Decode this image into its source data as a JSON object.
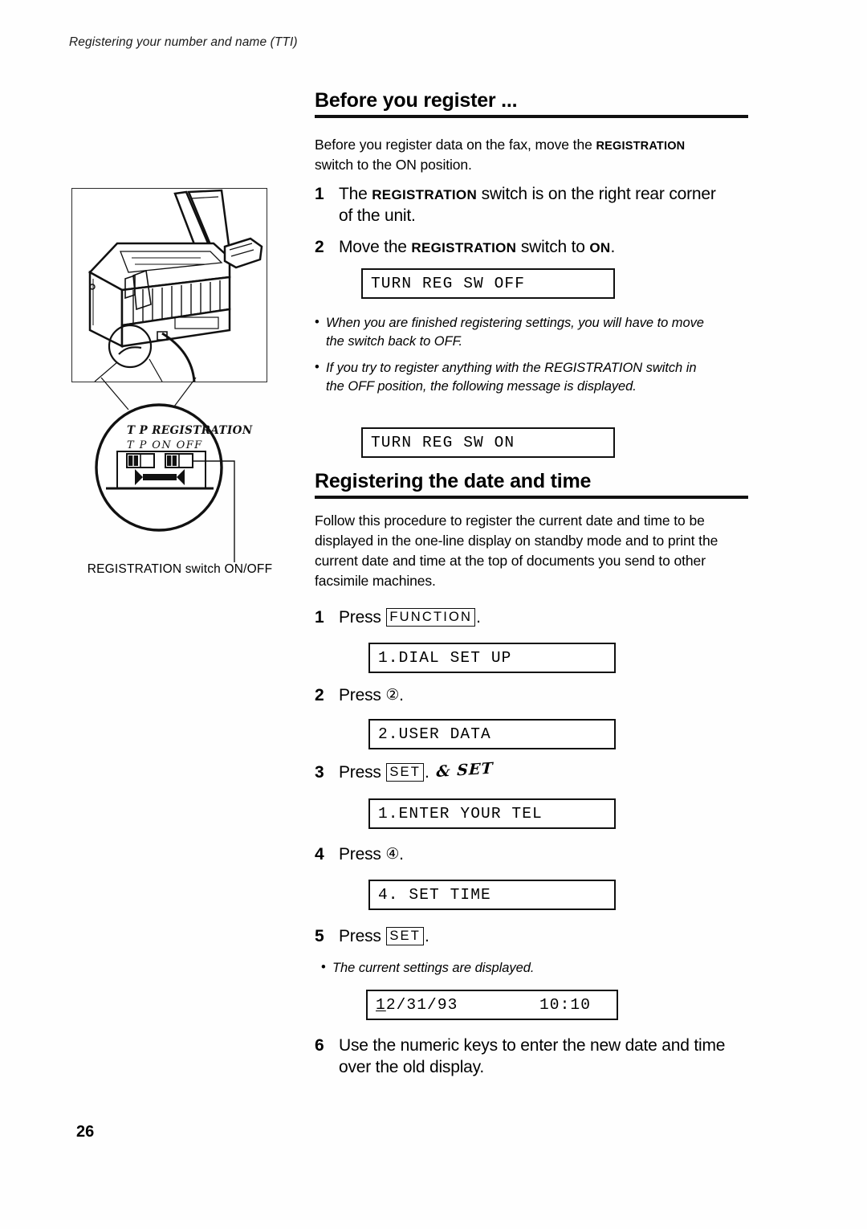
{
  "page": {
    "running_head": "Registering your number and name (TTI)",
    "number": "26"
  },
  "illustration": {
    "caption": "REGISTRATION switch ON/OFF",
    "callout_labels": {
      "line1": "T  P  REGISTRATION",
      "line2": "T   P   ON   OFF"
    }
  },
  "section1": {
    "heading": "Before you register ...",
    "intro_before": "Before you register data on the fax, move the ",
    "intro_sc": "REGISTRATION",
    "intro_after": " switch to the ON position.",
    "steps": [
      {
        "num": "1",
        "text_before": "The ",
        "sc": "REGISTRATION",
        "text_after": " switch is on the right rear corner of the unit."
      },
      {
        "num": "2",
        "text_before": "Move the ",
        "sc": "REGISTRATION",
        "text_mid": " switch to ",
        "sc2": "ON",
        "text_after": "."
      }
    ],
    "lcd1": "TURN REG SW OFF",
    "note1": "When you are finished registering settings, you will have to move the switch back to OFF.",
    "note2": "If you try to register anything with the REGISTRATION switch in the OFF position, the following message is displayed.",
    "lcd2": "TURN REG SW ON"
  },
  "section2": {
    "heading": "Registering the date and time",
    "intro": "Follow this procedure to register the current date and time to be displayed in the one-line display on standby mode and to print the current date and time at the top of documents you send to other facsimile machines.",
    "step1": {
      "num": "1",
      "press_label": "Press",
      "key": "FUNCTION",
      "period": ".",
      "lcd": "1.DIAL SET UP"
    },
    "step2": {
      "num": "2",
      "press_label": "Press",
      "key": "②",
      "period": ".",
      "lcd": "2.USER DATA"
    },
    "step3": {
      "num": "3",
      "press_label": "Press",
      "key": "SET",
      "period": ".",
      "handwritten_note": "& SET",
      "lcd": "1.ENTER YOUR TEL"
    },
    "step4": {
      "num": "4",
      "press_label": "Press",
      "key": "④",
      "period": ".",
      "lcd": "4. SET TIME"
    },
    "step5": {
      "num": "5",
      "press_label": "Press",
      "key": "SET",
      "period": ".",
      "note": "The current settings are displayed.",
      "lcd_date_cursor": "1",
      "lcd_date_rest": "2/31/93",
      "lcd_time": "10:10"
    },
    "step6": {
      "num": "6",
      "text": "Use the numeric keys to enter the new date and time over the old display."
    }
  }
}
